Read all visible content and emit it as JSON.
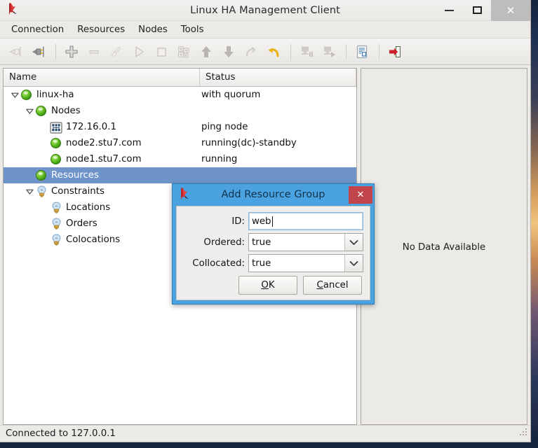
{
  "window": {
    "title": "Linux HA Management Client",
    "app_icon": "penguin-flag-icon",
    "minimize_label": "–",
    "maximize_label": "□",
    "close_label": "✕"
  },
  "menubar": {
    "items": [
      {
        "label": "Connection",
        "name": "menu-connection"
      },
      {
        "label": "Resources",
        "name": "menu-resources"
      },
      {
        "label": "Nodes",
        "name": "menu-nodes"
      },
      {
        "label": "Tools",
        "name": "menu-tools"
      }
    ]
  },
  "toolbar": {
    "buttons": [
      {
        "name": "disconnect-icon",
        "title": "Disconnect",
        "enabled": false
      },
      {
        "name": "connect-icon",
        "title": "Connect",
        "enabled": true
      },
      {
        "name": "add-icon",
        "title": "Add",
        "enabled": true
      },
      {
        "name": "remove-icon",
        "title": "Remove",
        "enabled": false
      },
      {
        "name": "cleanup-icon",
        "title": "Cleanup",
        "enabled": false
      },
      {
        "name": "start-icon",
        "title": "Start",
        "enabled": false
      },
      {
        "name": "stop-icon",
        "title": "Stop",
        "enabled": false
      },
      {
        "name": "manage-icon",
        "title": "Manage",
        "enabled": false
      },
      {
        "name": "move-up-icon",
        "title": "Move Up",
        "enabled": true
      },
      {
        "name": "move-down-icon",
        "title": "Move Down",
        "enabled": true
      },
      {
        "name": "redo-icon",
        "title": "Redo",
        "enabled": false
      },
      {
        "name": "undo-icon",
        "title": "Undo",
        "enabled": true
      },
      {
        "name": "standby-icon",
        "title": "Standby",
        "enabled": false
      },
      {
        "name": "online-icon",
        "title": "Online",
        "enabled": false
      },
      {
        "name": "report-icon",
        "title": "Report",
        "enabled": true
      },
      {
        "name": "exit-icon",
        "title": "Exit",
        "enabled": true
      }
    ]
  },
  "tree": {
    "columns": [
      {
        "label": "Name",
        "name": "column-header-name"
      },
      {
        "label": "Status",
        "name": "column-header-status"
      }
    ],
    "rows": [
      {
        "label": "linux-ha",
        "status": "with quorum",
        "indent": 0,
        "twisty": "expanded",
        "icon": "green-ball-icon",
        "selected": false
      },
      {
        "label": "Nodes",
        "status": "",
        "indent": 1,
        "twisty": "expanded",
        "icon": "green-ball-icon",
        "selected": false
      },
      {
        "label": "172.16.0.1",
        "status": "ping node",
        "indent": 2,
        "twisty": "none",
        "icon": "network-node-icon",
        "selected": false
      },
      {
        "label": "node2.stu7.com",
        "status": "running(dc)-standby",
        "indent": 2,
        "twisty": "none",
        "icon": "green-ball-icon",
        "selected": false
      },
      {
        "label": "node1.stu7.com",
        "status": "running",
        "indent": 2,
        "twisty": "none",
        "icon": "green-ball-icon",
        "selected": false
      },
      {
        "label": "Resources",
        "status": "",
        "indent": 1,
        "twisty": "none",
        "icon": "green-ball-icon",
        "selected": true
      },
      {
        "label": "Constraints",
        "status": "",
        "indent": 1,
        "twisty": "expanded",
        "icon": "lightbulb-icon",
        "selected": false
      },
      {
        "label": "Locations",
        "status": "",
        "indent": 2,
        "twisty": "none",
        "icon": "lightbulb-icon",
        "selected": false
      },
      {
        "label": "Orders",
        "status": "",
        "indent": 2,
        "twisty": "none",
        "icon": "lightbulb-icon",
        "selected": false
      },
      {
        "label": "Colocations",
        "status": "",
        "indent": 2,
        "twisty": "none",
        "icon": "lightbulb-icon",
        "selected": false
      }
    ]
  },
  "right_panel": {
    "empty_message": "No Data Available"
  },
  "statusbar": {
    "text": "Connected to 127.0.0.1"
  },
  "dialog": {
    "title": "Add Resource Group",
    "icon": "penguin-flag-icon",
    "close_label": "✕",
    "fields": {
      "id": {
        "label": "ID:",
        "value": "web",
        "placeholder": ""
      },
      "ordered": {
        "label": "Ordered:",
        "value": "true",
        "options": [
          "true",
          "false"
        ]
      },
      "collocated": {
        "label": "Collocated:",
        "value": "true",
        "options": [
          "true",
          "false"
        ]
      }
    },
    "buttons": {
      "ok": {
        "mnemonic": "O",
        "rest": "K"
      },
      "cancel": {
        "mnemonic": "C",
        "rest": "ancel"
      }
    }
  },
  "colors": {
    "selection": "#6e94c9",
    "dialog_titlebar": "#4aa3e0",
    "dialog_close": "#c0444a",
    "node_ok": "#6bc528",
    "window_bg": "#eceae7"
  }
}
